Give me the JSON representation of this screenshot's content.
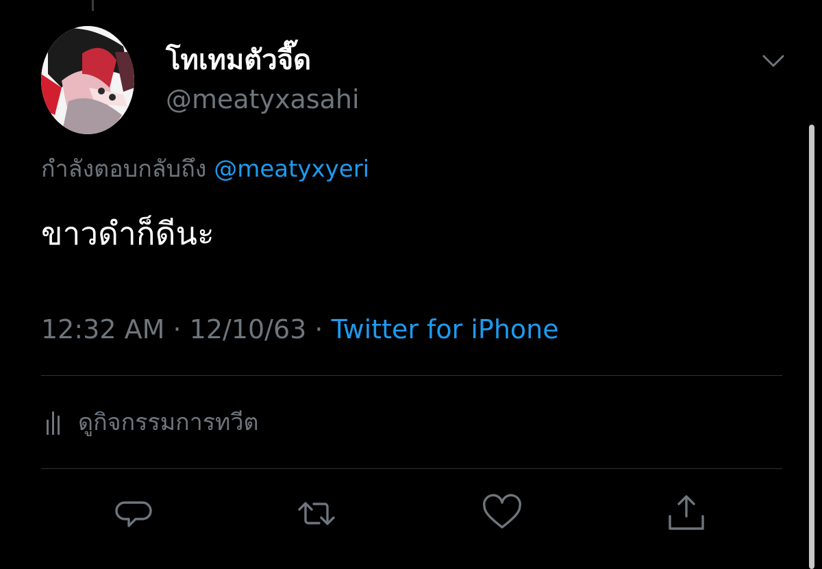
{
  "tweet": {
    "author": {
      "display_name": "โทเทมตัวจี๊ด",
      "handle": "@meatyxasahi"
    },
    "reply_to": {
      "prefix": "กำลังตอบกลับถึง",
      "mention": "@meatyxyeri"
    },
    "text": "ขาวดำก็ดีนะ",
    "meta": {
      "time": "12:32 AM",
      "separator": "·",
      "date": "12/10/63",
      "source": "Twitter for iPhone"
    },
    "activity_label": "ดูกิจกรรมการทวีต"
  },
  "icons": {
    "more": "chevron-down-icon",
    "activity": "analytics-bars-icon",
    "reply": "reply-bubble-icon",
    "retweet": "retweet-icon",
    "like": "heart-icon",
    "share": "share-upload-icon"
  },
  "colors": {
    "background": "#000000",
    "text_primary": "#ffffff",
    "text_secondary": "#6e767d",
    "accent": "#1d9bf0",
    "divider": "#2f3336",
    "icon": "#6e767d"
  }
}
